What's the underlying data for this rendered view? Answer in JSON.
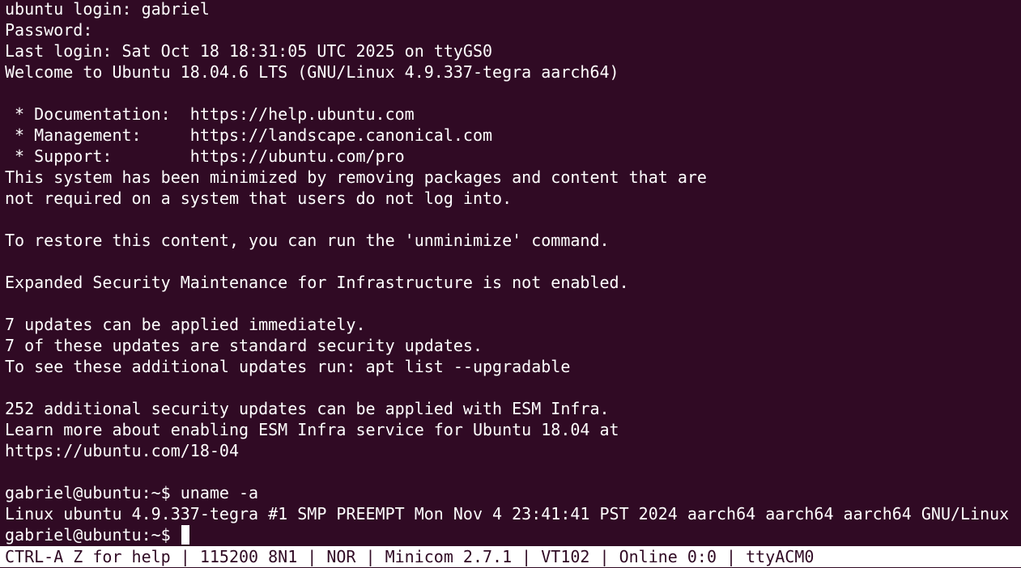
{
  "terminal": {
    "lines": [
      "ubuntu login: gabriel",
      "Password:",
      "Last login: Sat Oct 18 18:31:05 UTC 2025 on ttyGS0",
      "Welcome to Ubuntu 18.04.6 LTS (GNU/Linux 4.9.337-tegra aarch64)",
      "",
      " * Documentation:  https://help.ubuntu.com",
      " * Management:     https://landscape.canonical.com",
      " * Support:        https://ubuntu.com/pro",
      "This system has been minimized by removing packages and content that are",
      "not required on a system that users do not log into.",
      "",
      "To restore this content, you can run the 'unminimize' command.",
      "",
      "Expanded Security Maintenance for Infrastructure is not enabled.",
      "",
      "7 updates can be applied immediately.",
      "7 of these updates are standard security updates.",
      "To see these additional updates run: apt list --upgradable",
      "",
      "252 additional security updates can be applied with ESM Infra.",
      "Learn more about enabling ESM Infra service for Ubuntu 18.04 at",
      "https://ubuntu.com/18-04",
      "",
      "gabriel@ubuntu:~$ uname -a",
      "Linux ubuntu 4.9.337-tegra #1 SMP PREEMPT Mon Nov 4 23:41:41 PST 2024 aarch64 aarch64 aarch64 GNU/Linux"
    ],
    "prompt": "gabriel@ubuntu:~$ ",
    "colors": {
      "background": "#300a24",
      "foreground": "#ffffff"
    }
  },
  "status_bar": {
    "text": "CTRL-A Z for help | 115200 8N1 | NOR | Minicom 2.7.1 | VT102 | Online 0:0 | ttyACM0"
  }
}
